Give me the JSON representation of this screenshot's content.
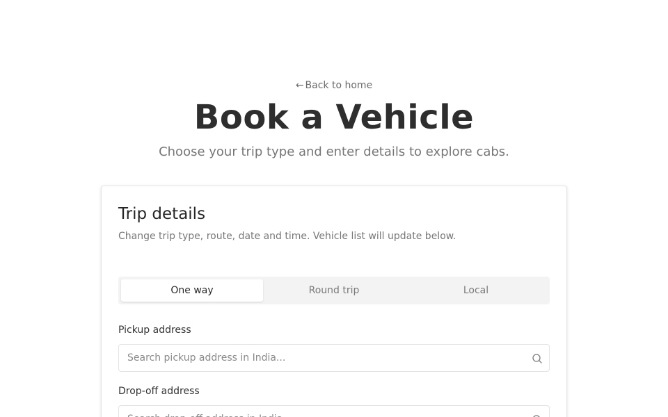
{
  "nav": {
    "back_arrow": "←",
    "back_label": "Back to home"
  },
  "header": {
    "title": "Book a Vehicle",
    "subtitle": "Choose your trip type and enter details to explore cabs."
  },
  "card": {
    "title": "Trip details",
    "description": "Change trip type, route, date and time. Vehicle list will update below.",
    "tabs": [
      {
        "label": "One way",
        "active": true
      },
      {
        "label": "Round trip",
        "active": false
      },
      {
        "label": "Local",
        "active": false
      }
    ],
    "pickup": {
      "label": "Pickup address",
      "placeholder": "Search pickup address in India...",
      "icon": "search-icon"
    },
    "dropoff": {
      "label": "Drop-off address",
      "placeholder": "Search drop-off address in India...",
      "icon": "search-icon"
    }
  }
}
